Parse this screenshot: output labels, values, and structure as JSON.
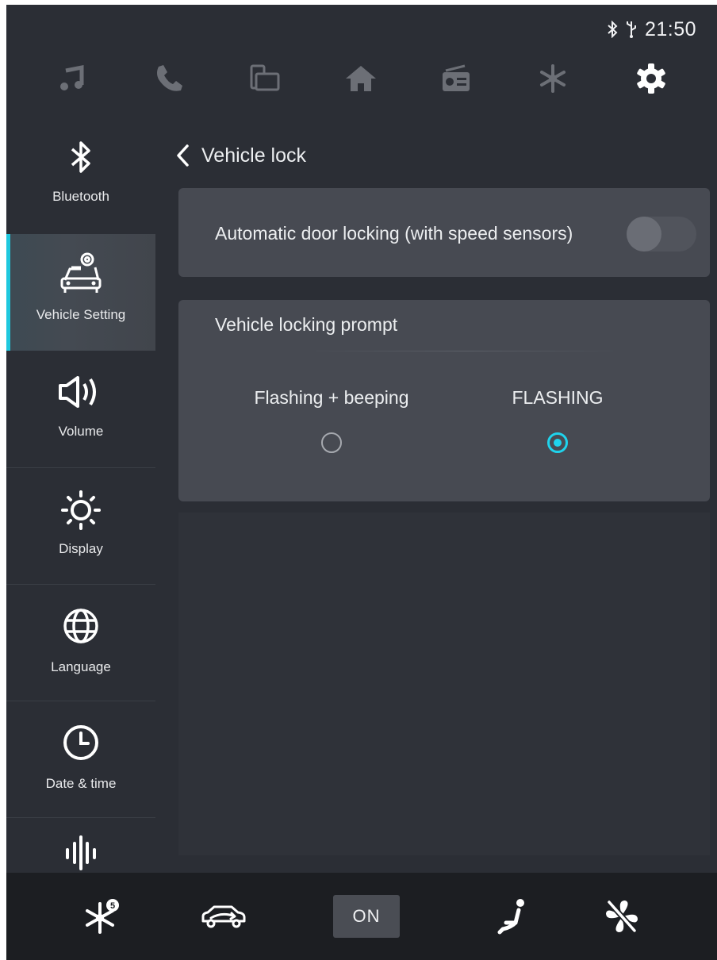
{
  "status": {
    "time": "21:50",
    "icons": [
      "bluetooth-icon",
      "usb-icon"
    ]
  },
  "topnav": {
    "items": [
      "music-icon",
      "phone-icon",
      "mirroring-icon",
      "home-icon",
      "radio-icon",
      "climate-icon",
      "settings-icon"
    ],
    "active": "settings-icon"
  },
  "sidebar": {
    "items": [
      {
        "label": "Bluetooth",
        "icon": "bluetooth-icon"
      },
      {
        "label": "Vehicle Setting",
        "icon": "car-settings-icon",
        "active": true
      },
      {
        "label": "Volume",
        "icon": "speaker-icon"
      },
      {
        "label": "Display",
        "icon": "brightness-icon"
      },
      {
        "label": "Language",
        "icon": "globe-icon"
      },
      {
        "label": "Date & time",
        "icon": "clock-icon"
      },
      {
        "label": "",
        "icon": "sound-wave-icon"
      }
    ]
  },
  "page": {
    "title": "Vehicle lock"
  },
  "auto_lock": {
    "label": "Automatic door locking (with speed sensors)",
    "enabled": false
  },
  "lock_prompt": {
    "title": "Vehicle locking prompt",
    "options": [
      {
        "label": "Flashing + beeping",
        "selected": false
      },
      {
        "label": "FLASHING",
        "selected": true
      }
    ]
  },
  "bottombar": {
    "on_label": "ON",
    "icons": [
      "snowflake-icon",
      "car-recirculation-icon",
      "seat-heating-icon",
      "fan-off-icon"
    ]
  },
  "colors": {
    "accent": "#1fd3ec",
    "background": "#2b2e35",
    "card": "#474a52",
    "bottom_bar": "#1c1e22"
  }
}
